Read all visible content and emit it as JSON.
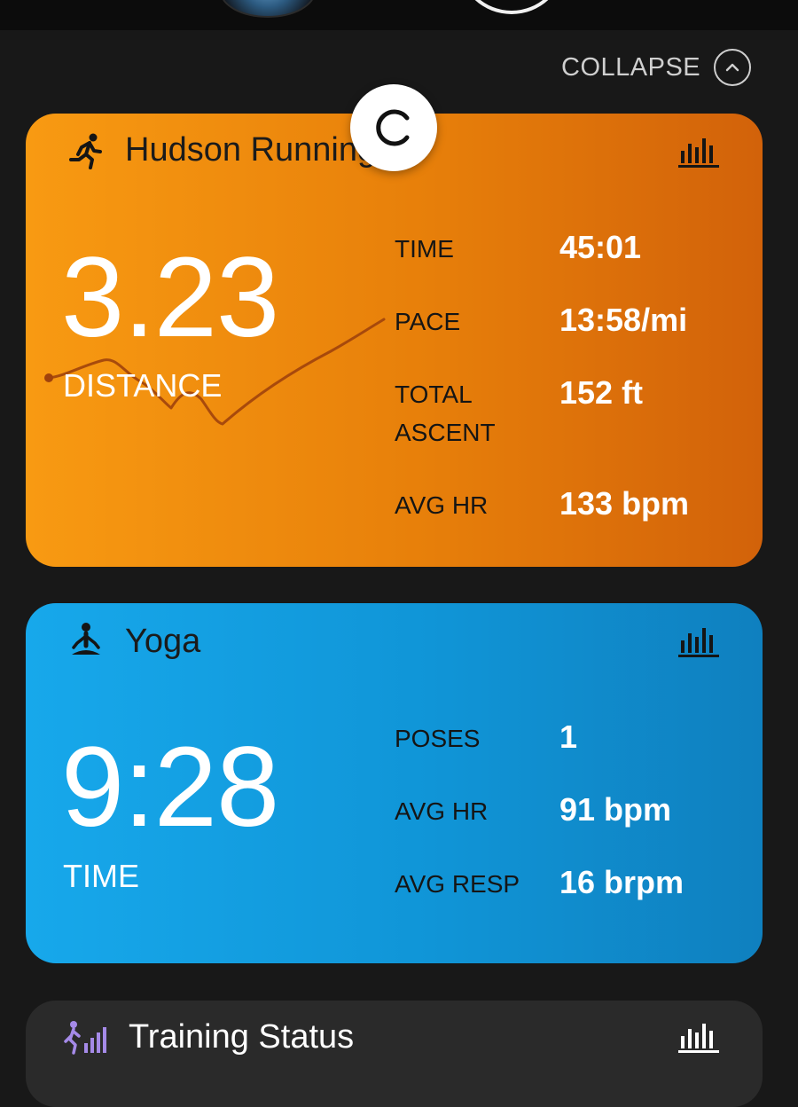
{
  "collapse": {
    "label": "COLLAPSE"
  },
  "icons": {
    "run": "running-person-icon",
    "yoga": "meditation-icon",
    "chart": "bar-chart-icon",
    "refresh": "refresh-icon",
    "collapse": "chevron-up-icon",
    "training": "training-status-icon"
  },
  "colors": {
    "running_card": "#f08a0e",
    "yoga_card": "#139ee0",
    "training_icon": "#a58ae8"
  },
  "running": {
    "title": "Hudson Running",
    "big_value": "3.23",
    "big_label": "DISTANCE",
    "stats": [
      {
        "label": "TIME",
        "value": "45:01"
      },
      {
        "label": "PACE",
        "value": "13:58/mi"
      },
      {
        "label": "TOTAL ASCENT",
        "value": "152 ft"
      },
      {
        "label": "AVG HR",
        "value": "133 bpm"
      }
    ]
  },
  "yoga": {
    "title": "Yoga",
    "big_value": "9:28",
    "big_label": "TIME",
    "stats": [
      {
        "label": "POSES",
        "value": "1"
      },
      {
        "label": "AVG HR",
        "value": "91 bpm"
      },
      {
        "label": "AVG RESP",
        "value": "16 brpm"
      }
    ]
  },
  "training": {
    "title": "Training Status"
  }
}
